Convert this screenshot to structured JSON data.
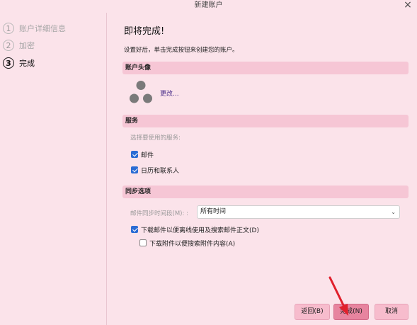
{
  "window": {
    "title": "新建账户"
  },
  "sidebar": {
    "steps": [
      {
        "num": "1",
        "label": "账户详细信息"
      },
      {
        "num": "2",
        "label": "加密"
      },
      {
        "num": "3",
        "label": "完成"
      }
    ]
  },
  "main": {
    "heading": "即将完成!",
    "intro": "设置好后，单击完成按钮来创建您的账户。",
    "avatar_section": {
      "title": "账户头像",
      "change_link": "更改..."
    },
    "services_section": {
      "title": "服务",
      "prompt": "选择要使用的服务:",
      "items": [
        {
          "label": "邮件",
          "checked": true
        },
        {
          "label": "日历和联系人",
          "checked": true
        }
      ]
    },
    "sync_section": {
      "title": "同步选项",
      "period_label": "邮件同步时间段(M): :",
      "period_value": "所有时间",
      "download_mail": {
        "label": "下载邮件以便离线使用及搜索邮件正文(D)",
        "checked": true
      },
      "download_attachments": {
        "label": "下载附件以便搜索附件内容(A)",
        "checked": false
      }
    }
  },
  "footer": {
    "back": "返回(B)",
    "finish": "完成(N)",
    "cancel": "取消"
  },
  "colors": {
    "accent": "#e7849f",
    "checkbox": "#2b6cd4",
    "arrow": "#e0202c",
    "section": "#f6c6d5"
  },
  "icons": {
    "close": "close-icon",
    "avatar": "person-icon",
    "dropdown": "chevron-down-icon"
  }
}
